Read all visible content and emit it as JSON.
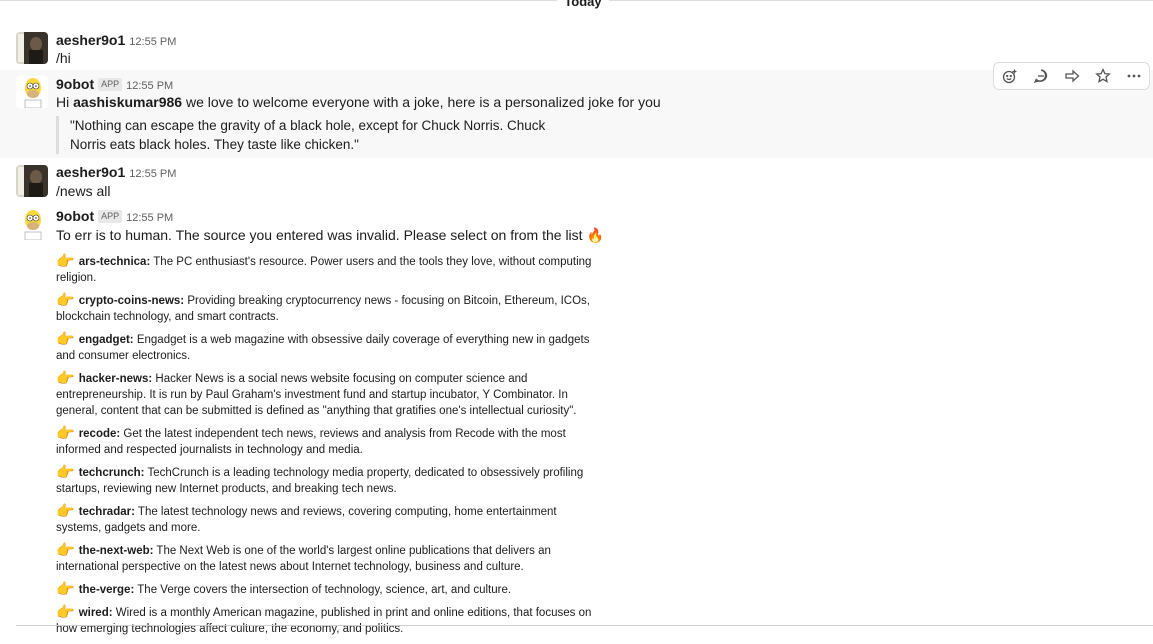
{
  "divider": {
    "label": "Today"
  },
  "messages": [
    {
      "user": "aesher9o1",
      "time": "12:55 PM",
      "text": "/hi"
    },
    {
      "user": "9obot",
      "badge": "APP",
      "time": "12:55 PM",
      "text_prefix": "Hi ",
      "mention": "aashiskumar986",
      "text_suffix": " we love to welcome everyone with a joke, here is a personalized joke for you",
      "quote": "\"Nothing can escape the gravity of a black hole, except for Chuck Norris. Chuck Norris eats black holes. They taste like chicken.\""
    },
    {
      "user": "aesher9o1",
      "time": "12:55 PM",
      "text": "/news all"
    },
    {
      "user": "9obot",
      "badge": "APP",
      "time": "12:55 PM",
      "text": "To err is to human. The source you entered was invalid. Please select on from the list",
      "emoji": "🔥"
    }
  ],
  "toolbar": {
    "buttons": [
      "add-reaction-icon",
      "reply-thread-icon",
      "share-icon",
      "star-icon",
      "more-icon"
    ]
  },
  "sources": [
    {
      "key": "ars-technica:",
      "desc": " The PC enthusiast's resource. Power users and the tools they love, without computing religion."
    },
    {
      "key": "crypto-coins-news:",
      "desc": " Providing breaking cryptocurrency news - focusing on Bitcoin, Ethereum, ICOs, blockchain technology, and smart contracts."
    },
    {
      "key": "engadget:",
      "desc": " Engadget is a web magazine with obsessive daily coverage of everything new in gadgets and consumer electronics."
    },
    {
      "key": "hacker-news:",
      "desc": " Hacker News is a social news website focusing on computer science and entrepreneurship. It is run by Paul Graham's investment fund and startup incubator, Y Combinator. In general, content that can be submitted is defined as \"anything that gratifies one's intellectual curiosity\"."
    },
    {
      "key": "recode:",
      "desc": " Get the latest independent tech news, reviews and analysis from Recode with the most informed and respected journalists in technology and media."
    },
    {
      "key": "techcrunch:",
      "desc": " TechCrunch is a leading technology media property, dedicated to obsessively profiling startups, reviewing new Internet products, and breaking tech news."
    },
    {
      "key": "techradar:",
      "desc": " The latest technology news and reviews, covering computing, home entertainment systems, gadgets and more."
    },
    {
      "key": "the-next-web:",
      "desc": " The Next Web is one of the world's largest online publications that delivers an international perspective on the latest news about Internet technology, business and culture."
    },
    {
      "key": "the-verge:",
      "desc": " The Verge covers the intersection of technology, science, art, and culture."
    },
    {
      "key": "wired:",
      "desc": " Wired is a monthly American magazine, published in print and online editions, that focuses on how emerging technologies affect culture, the economy, and politics."
    }
  ],
  "pointer_emoji": "👉"
}
